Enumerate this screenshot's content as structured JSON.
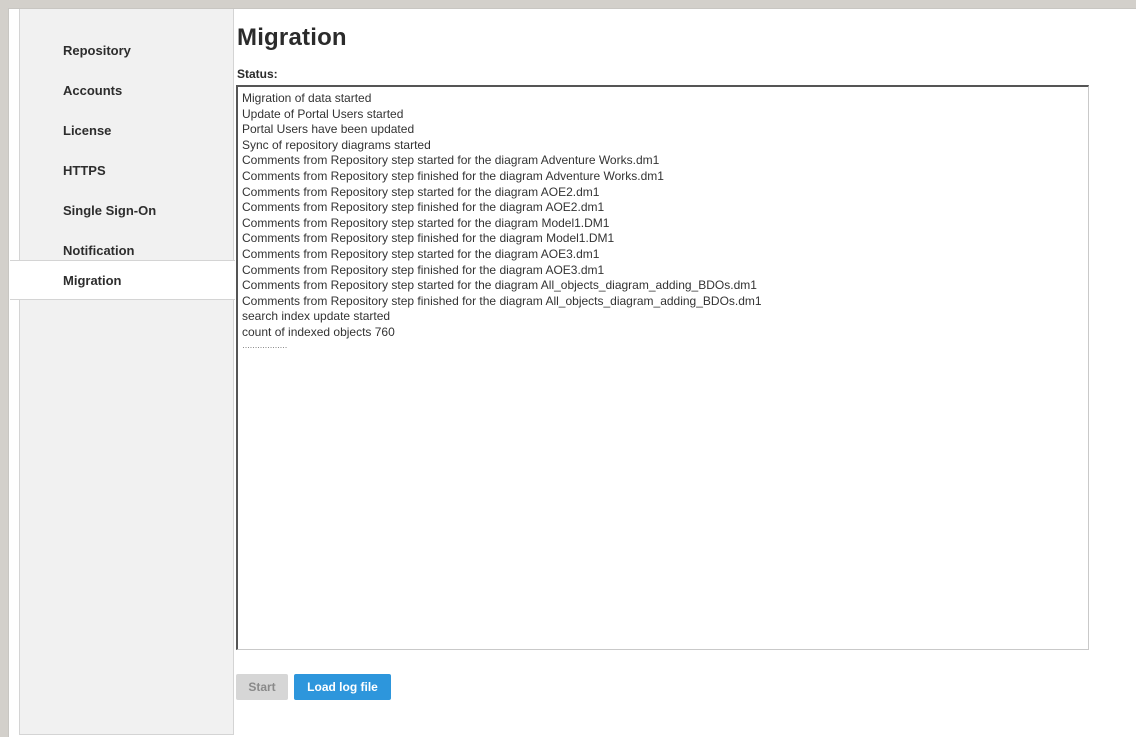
{
  "sidebar": {
    "items": [
      {
        "label": "Repository"
      },
      {
        "label": "Accounts"
      },
      {
        "label": "License"
      },
      {
        "label": "HTTPS"
      },
      {
        "label": "Single Sign-On"
      },
      {
        "label": "Notification"
      },
      {
        "label": "Migration",
        "active": true
      }
    ]
  },
  "main": {
    "title": "Migration",
    "status_label": "Status:",
    "log_lines": [
      "Migration of data started",
      "Update of Portal Users started",
      "Portal Users have been updated",
      "Sync of repository diagrams started",
      "Comments from Repository step started for the diagram Adventure Works.dm1",
      "Comments from Repository step finished for the diagram Adventure Works.dm1",
      "Comments from Repository step started for the diagram AOE2.dm1",
      "Comments from Repository step finished for the diagram AOE2.dm1",
      "Comments from Repository step started for the diagram Model1.DM1",
      "Comments from Repository step finished for the diagram Model1.DM1",
      "Comments from Repository step started for the diagram AOE3.dm1",
      "Comments from Repository step finished for the diagram AOE3.dm1",
      "Comments from Repository step started for the diagram All_objects_diagram_adding_BDOs.dm1",
      "Comments from Repository step finished for the diagram All_objects_diagram_adding_BDOs.dm1",
      "search index update started",
      "count of indexed objects 760"
    ],
    "log_trailing": "………………"
  },
  "buttons": {
    "start_label": "Start",
    "start_enabled": false,
    "load_label": "Load log file"
  },
  "colors": {
    "accent": "#2d96dc",
    "disabled": "#d6d6d6",
    "sidebar_bg": "#f1f1f1"
  }
}
